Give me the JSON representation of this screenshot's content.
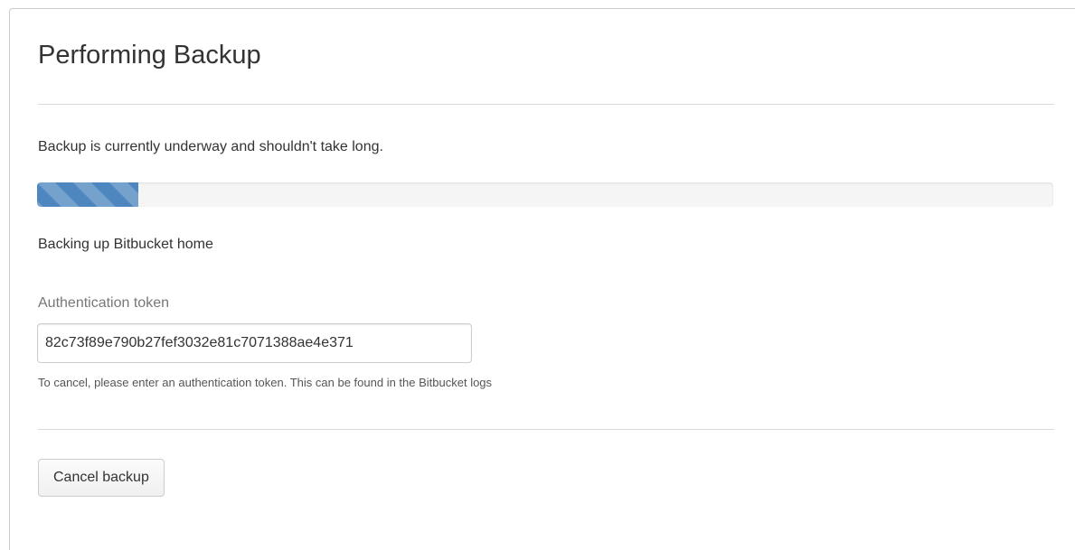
{
  "page": {
    "title": "Performing Backup",
    "status_message": "Backup is currently underway and shouldn't take long.",
    "progress": {
      "percent": 10,
      "accent_color": "#4e86bf"
    },
    "current_step": "Backing up Bitbucket home"
  },
  "auth": {
    "label": "Authentication token",
    "value": "82c73f89e790b27fef3032e81c7071388ae4e371",
    "help": "To cancel, please enter an authentication token. This can be found in the Bitbucket logs"
  },
  "actions": {
    "cancel_label": "Cancel backup"
  }
}
